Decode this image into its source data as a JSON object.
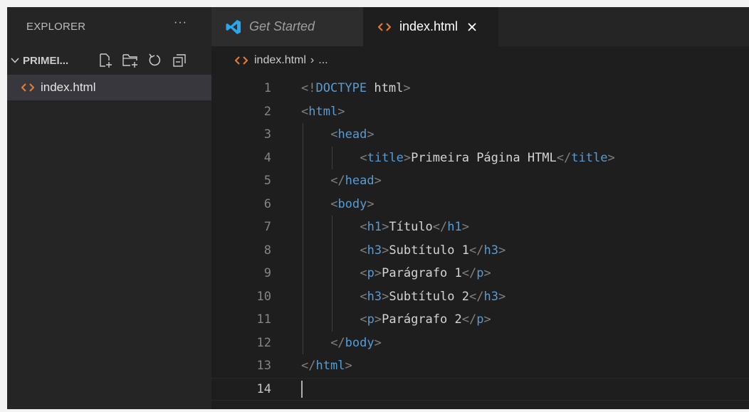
{
  "sidebar": {
    "title": "EXPLORER",
    "more": "···",
    "folder": "PRIMEI...",
    "files": [
      {
        "name": "index.html",
        "icon": "html-file-icon"
      }
    ]
  },
  "tabs": [
    {
      "label": "Get Started",
      "icon": "vscode-logo-icon",
      "active": false
    },
    {
      "label": "index.html",
      "icon": "html-file-icon",
      "active": true,
      "close": "close-icon"
    }
  ],
  "breadcrumb": {
    "file": "index.html",
    "separator": "›",
    "rest": "..."
  },
  "editor": {
    "current_line": 14,
    "lines": [
      {
        "n": "1",
        "indent": 0,
        "tokens": [
          [
            "p",
            "<!"
          ],
          [
            "t",
            "DOCTYPE "
          ],
          [
            "x",
            "html"
          ],
          [
            "p",
            ">"
          ]
        ]
      },
      {
        "n": "2",
        "indent": 0,
        "tokens": [
          [
            "p",
            "<"
          ],
          [
            "t",
            "html"
          ],
          [
            "p",
            ">"
          ]
        ]
      },
      {
        "n": "3",
        "indent": 1,
        "tokens": [
          [
            "p",
            "<"
          ],
          [
            "t",
            "head"
          ],
          [
            "p",
            ">"
          ]
        ]
      },
      {
        "n": "4",
        "indent": 2,
        "tokens": [
          [
            "p",
            "<"
          ],
          [
            "t",
            "title"
          ],
          [
            "p",
            ">"
          ],
          [
            "x",
            "Primeira Página HTML"
          ],
          [
            "p",
            "</"
          ],
          [
            "t",
            "title"
          ],
          [
            "p",
            ">"
          ]
        ]
      },
      {
        "n": "5",
        "indent": 1,
        "tokens": [
          [
            "p",
            "</"
          ],
          [
            "t",
            "head"
          ],
          [
            "p",
            ">"
          ]
        ]
      },
      {
        "n": "6",
        "indent": 1,
        "tokens": [
          [
            "p",
            "<"
          ],
          [
            "t",
            "body"
          ],
          [
            "p",
            ">"
          ]
        ]
      },
      {
        "n": "7",
        "indent": 2,
        "tokens": [
          [
            "p",
            "<"
          ],
          [
            "t",
            "h1"
          ],
          [
            "p",
            ">"
          ],
          [
            "x",
            "Título"
          ],
          [
            "p",
            "</"
          ],
          [
            "t",
            "h1"
          ],
          [
            "p",
            ">"
          ]
        ]
      },
      {
        "n": "8",
        "indent": 2,
        "tokens": [
          [
            "p",
            "<"
          ],
          [
            "t",
            "h3"
          ],
          [
            "p",
            ">"
          ],
          [
            "x",
            "Subtítulo 1"
          ],
          [
            "p",
            "</"
          ],
          [
            "t",
            "h3"
          ],
          [
            "p",
            ">"
          ]
        ]
      },
      {
        "n": "9",
        "indent": 2,
        "tokens": [
          [
            "p",
            "<"
          ],
          [
            "t",
            "p"
          ],
          [
            "p",
            ">"
          ],
          [
            "x",
            "Parágrafo 1"
          ],
          [
            "p",
            "</"
          ],
          [
            "t",
            "p"
          ],
          [
            "p",
            ">"
          ]
        ]
      },
      {
        "n": "10",
        "indent": 2,
        "tokens": [
          [
            "p",
            "<"
          ],
          [
            "t",
            "h3"
          ],
          [
            "p",
            ">"
          ],
          [
            "x",
            "Subtítulo 2"
          ],
          [
            "p",
            "</"
          ],
          [
            "t",
            "h3"
          ],
          [
            "p",
            ">"
          ]
        ]
      },
      {
        "n": "11",
        "indent": 2,
        "tokens": [
          [
            "p",
            "<"
          ],
          [
            "t",
            "p"
          ],
          [
            "p",
            ">"
          ],
          [
            "x",
            "Parágrafo 2"
          ],
          [
            "p",
            "</"
          ],
          [
            "t",
            "p"
          ],
          [
            "p",
            ">"
          ]
        ]
      },
      {
        "n": "12",
        "indent": 1,
        "tokens": [
          [
            "p",
            "</"
          ],
          [
            "t",
            "body"
          ],
          [
            "p",
            ">"
          ]
        ]
      },
      {
        "n": "13",
        "indent": 0,
        "tokens": [
          [
            "p",
            "</"
          ],
          [
            "t",
            "html"
          ],
          [
            "p",
            ">"
          ]
        ]
      },
      {
        "n": "14",
        "indent": 0,
        "tokens": []
      }
    ]
  },
  "colors": {
    "punctuation": "#808080",
    "tag": "#569cd6",
    "text": "#d4d4d4",
    "html_icon": "#e37933",
    "vscode_logo": "#23a9f2"
  }
}
